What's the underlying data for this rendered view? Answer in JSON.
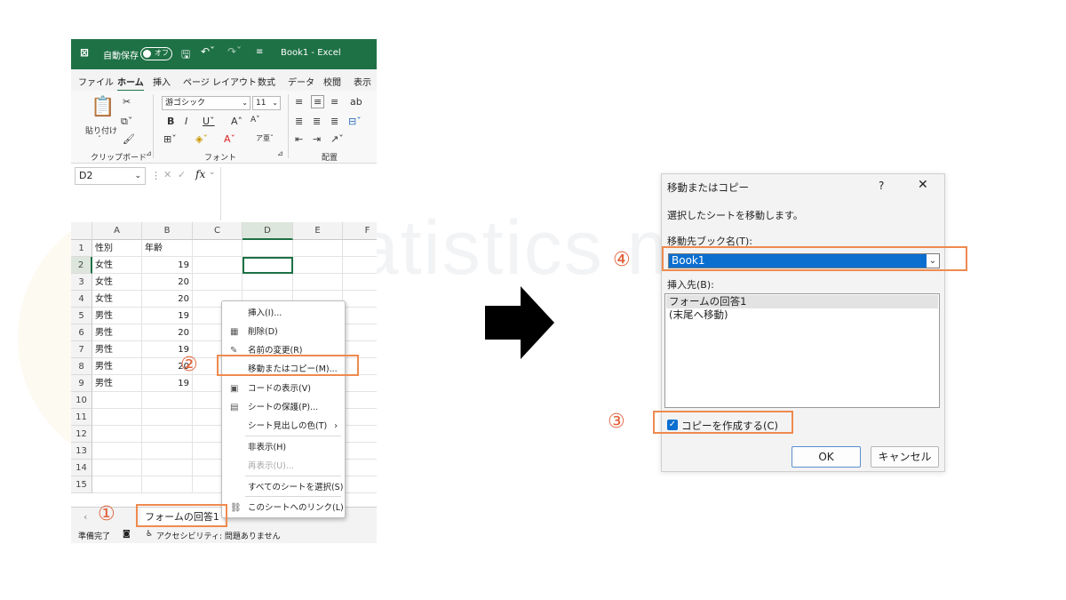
{
  "watermark": "statistics mate",
  "excel": {
    "title": "Book1 - Excel",
    "autosave_label": "自動保存",
    "autosave_state": "オフ",
    "ribbon_tabs": [
      "ファイル",
      "ホーム",
      "挿入",
      "ページ レイアウト",
      "数式",
      "データ",
      "校閲",
      "表示"
    ],
    "paste_label": "貼り付け",
    "font_name": "游ゴシック",
    "font_size": "11",
    "group_labels": [
      "クリップボード",
      "フォント",
      "配置"
    ],
    "name_box": "D2",
    "fx": "fx",
    "column_headers": [
      "A",
      "B",
      "C",
      "D",
      "E",
      "F"
    ],
    "row_headers": [
      "1",
      "2",
      "3",
      "4",
      "5",
      "6",
      "7",
      "8",
      "9",
      "10",
      "11",
      "12",
      "13",
      "14",
      "15"
    ],
    "rows": [
      [
        "性別",
        "年齢"
      ],
      [
        "女性",
        "19"
      ],
      [
        "女性",
        "20"
      ],
      [
        "女性",
        "20"
      ],
      [
        "男性",
        "19"
      ],
      [
        "男性",
        "20"
      ],
      [
        "男性",
        "19"
      ],
      [
        "男性",
        "20"
      ],
      [
        "男性",
        "19"
      ]
    ],
    "sheet_tab": "フォームの回答1",
    "status_ready": "準備完了",
    "status_accessibility": "アクセシビリティ: 問題ありません"
  },
  "context_menu": {
    "items": [
      {
        "label": "挿入(I)...",
        "icon": ""
      },
      {
        "label": "削除(D)",
        "icon": "delete-sheet-icon"
      },
      {
        "label": "名前の変更(R)",
        "icon": "rename-icon"
      },
      {
        "label": "移動またはコピー(M)...",
        "icon": ""
      },
      {
        "label": "コードの表示(V)",
        "icon": "view-code-icon"
      },
      {
        "label": "シートの保護(P)...",
        "icon": "protect-sheet-icon"
      },
      {
        "label": "シート見出しの色(T)",
        "icon": ""
      },
      {
        "label": "非表示(H)",
        "icon": ""
      },
      {
        "label": "再表示(U)...",
        "icon": "",
        "disabled": true
      },
      {
        "label": "すべてのシートを選択(S)",
        "icon": ""
      },
      {
        "label": "このシートへのリンク(L)",
        "icon": "link-icon"
      }
    ]
  },
  "annotations": {
    "one": "①",
    "two": "②",
    "three": "③",
    "four": "④"
  },
  "dialog": {
    "title": "移動またはコピー",
    "help": "?",
    "close": "✕",
    "instruction": "選択したシートを移動します。",
    "dest_book_label": "移動先ブック名(T):",
    "dest_book_value": "Book1",
    "insert_before_label": "挿入先(B):",
    "insert_before_items": [
      "フォームの回答1",
      "(末尾へ移動)"
    ],
    "copy_label": "コピーを作成する(C)",
    "copy_checked": true,
    "ok": "OK",
    "cancel": "キャンセル"
  },
  "colors": {
    "excel_green": "#1e7145",
    "highlight": "#ef8a4f",
    "annotation_number": "#e2613a",
    "selection_blue": "#0b6fd0"
  }
}
